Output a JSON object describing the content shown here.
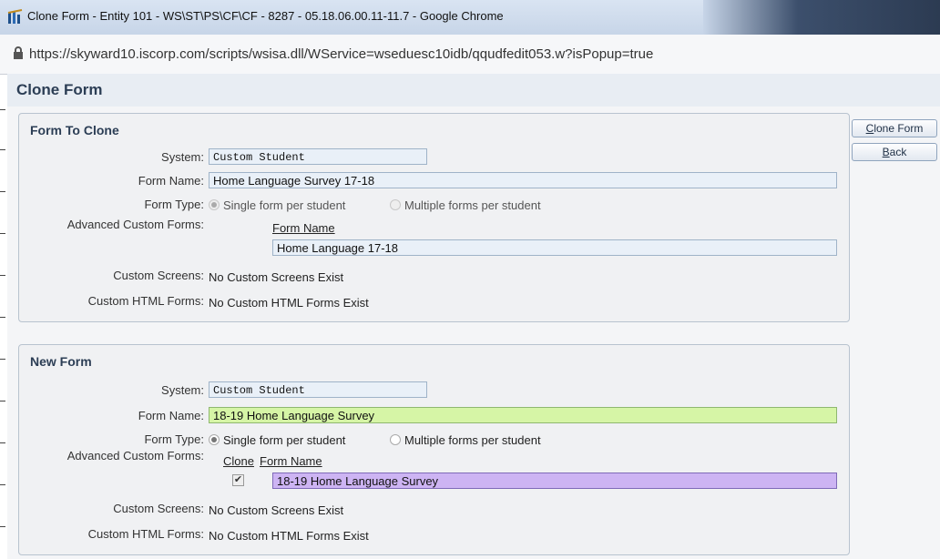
{
  "window": {
    "title": "Clone Form - Entity 101 - WS\\ST\\PS\\CF\\CF - 8287 - 05.18.06.00.11-11.7 - Google Chrome",
    "url": "https://skyward10.iscorp.com/scripts/wsisa.dll/WService=wseduesc10idb/qqudfedit053.w?isPopup=true"
  },
  "page": {
    "title": "Clone Form"
  },
  "form_to_clone": {
    "heading": "Form To Clone",
    "system_label": "System:",
    "system_value": "Custom Student",
    "form_name_label": "Form Name:",
    "form_name_value": "Home Language Survey 17-18",
    "form_type_label": "Form Type:",
    "form_type_option_single": "Single form per student",
    "form_type_option_multiple": "Multiple forms per student",
    "form_type_selected": "single",
    "advanced_label": "Advanced Custom Forms:",
    "advanced_col_form_name": "Form Name",
    "advanced_rows": [
      {
        "form_name": "Home Language 17-18"
      }
    ],
    "custom_screens_label": "Custom Screens:",
    "custom_screens_value": "No Custom Screens Exist",
    "custom_html_label": "Custom HTML Forms:",
    "custom_html_value": "No Custom HTML Forms Exist"
  },
  "new_form": {
    "heading": "New Form",
    "system_label": "System:",
    "system_value": "Custom Student",
    "form_name_label": "Form Name:",
    "form_name_value": "18-19 Home Language Survey",
    "form_type_label": "Form Type:",
    "form_type_option_single": "Single form per student",
    "form_type_option_multiple": "Multiple forms per student",
    "form_type_selected": "single",
    "advanced_label": "Advanced Custom Forms:",
    "advanced_col_clone": "Clone",
    "advanced_col_form_name": "Form Name",
    "advanced_rows": [
      {
        "clone": true,
        "form_name": "18-19 Home Language Survey"
      }
    ],
    "custom_screens_label": "Custom Screens:",
    "custom_screens_value": "No Custom Screens Exist",
    "custom_html_label": "Custom HTML Forms:",
    "custom_html_value": "No Custom HTML Forms Exist"
  },
  "buttons": {
    "clone_form": {
      "accel": "C",
      "rest": "lone Form"
    },
    "back": {
      "accel": "B",
      "rest": "ack"
    }
  },
  "colors": {
    "new_form_name_bg": "#d6f5a6",
    "new_advanced_form_name_bg": "#cdb4f3",
    "header_text": "#2c3e55"
  }
}
